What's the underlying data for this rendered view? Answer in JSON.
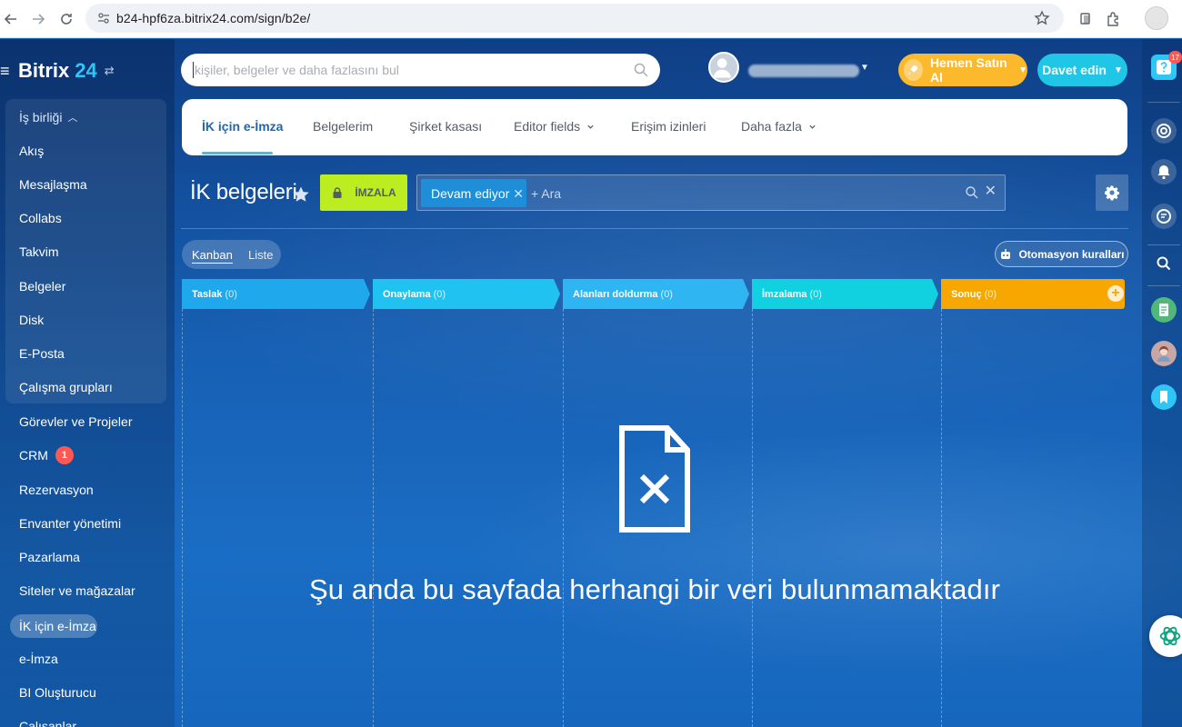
{
  "browser": {
    "url": "b24-hpf6za.bitrix24.com/sign/b2e/"
  },
  "logo": {
    "name": "Bitrix",
    "number": "24"
  },
  "sidebar": {
    "group_header": "İş birliği",
    "group_items": [
      "Akış",
      "Mesajlaşma",
      "Collabs",
      "Takvim",
      "Belgeler",
      "Disk",
      "E-Posta",
      "Çalışma grupları"
    ],
    "items": [
      "Görevler ve Projeler",
      "CRM",
      "Rezervasyon",
      "Envanter yönetimi",
      "Pazarlama",
      "Siteler ve mağazalar",
      "İK için e-İmza",
      "e-İmza",
      "BI Oluşturucu",
      "Çalışanlar"
    ],
    "crm_badge": "1",
    "active_item": "İK için e-İmza"
  },
  "header": {
    "search_placeholder": "kişiler, belgeler ve daha fazlasını bul",
    "buy_label": "Hemen Satın Al",
    "invite_label": "Davet edin"
  },
  "tabs": [
    "İK için e-İmza",
    "Belgelerim",
    "Şirket kasası",
    "Editor fields",
    "Erişim izinleri",
    "Daha fazla"
  ],
  "toolbar": {
    "title": "İK belgeleri",
    "sign_label": "İMZALA",
    "filter_chip": "Devam ediyor",
    "filter_add": "+ Ara"
  },
  "views": {
    "kanban": "Kanban",
    "list": "Liste",
    "automation": "Otomasyon kuralları"
  },
  "stages": [
    {
      "name": "Taslak",
      "count": "(0)",
      "color": "#1fa8ec"
    },
    {
      "name": "Onaylama",
      "count": "(0)",
      "color": "#1fc2f0"
    },
    {
      "name": "Alanları doldurma",
      "count": "(0)",
      "color": "#2fb5f2"
    },
    {
      "name": "İmzalama",
      "count": "(0)",
      "color": "#11d0e0"
    },
    {
      "name": "Sonuç",
      "count": "(0)",
      "color": "#f7a700"
    }
  ],
  "empty_state": "Şu anda bu sayfada herhangi bir veri bulunmamaktadır",
  "rightbar": {
    "help_badge": "17"
  },
  "colors": {
    "accent": "#2fc6f6",
    "sign_button": "#bbed21",
    "buy_button": "#fcb92b",
    "invite_button": "#20c6e5",
    "badge": "#ff5752"
  }
}
